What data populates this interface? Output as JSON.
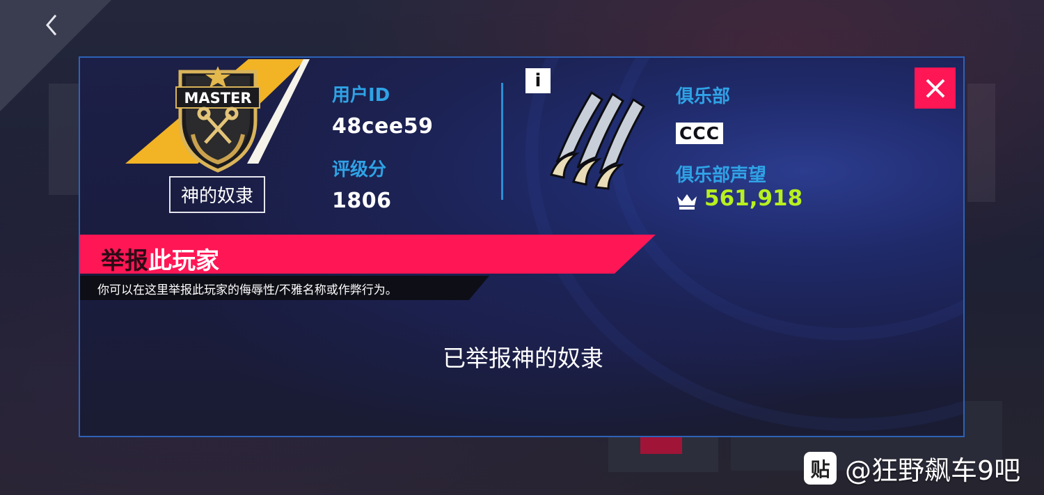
{
  "player": {
    "rank_badge": "MASTER",
    "rank_title": "神的奴隶",
    "user_id_label": "用户ID",
    "user_id": "48cee59",
    "rating_label": "评级分",
    "rating": "1806"
  },
  "club": {
    "info_label": "i",
    "club_label": "俱乐部",
    "club_name": "CCC",
    "reputation_label": "俱乐部声望",
    "reputation": "561,918"
  },
  "report": {
    "title_part1": "举报",
    "title_part2": "此玩家",
    "subtitle": "你可以在这里举报此玩家的侮辱性/不雅名称或作弊行为。",
    "status": "已举报神的奴隶"
  },
  "nav": {
    "back_icon": "chevron-left-icon"
  },
  "watermark": {
    "icon_label": "贴",
    "text": "@狂野飙车9吧"
  },
  "colors": {
    "accent_pink": "#ff1654",
    "label_blue": "#2fa3e6",
    "reputation_green": "#b8f01f",
    "rank_gold": "#f2b325"
  }
}
